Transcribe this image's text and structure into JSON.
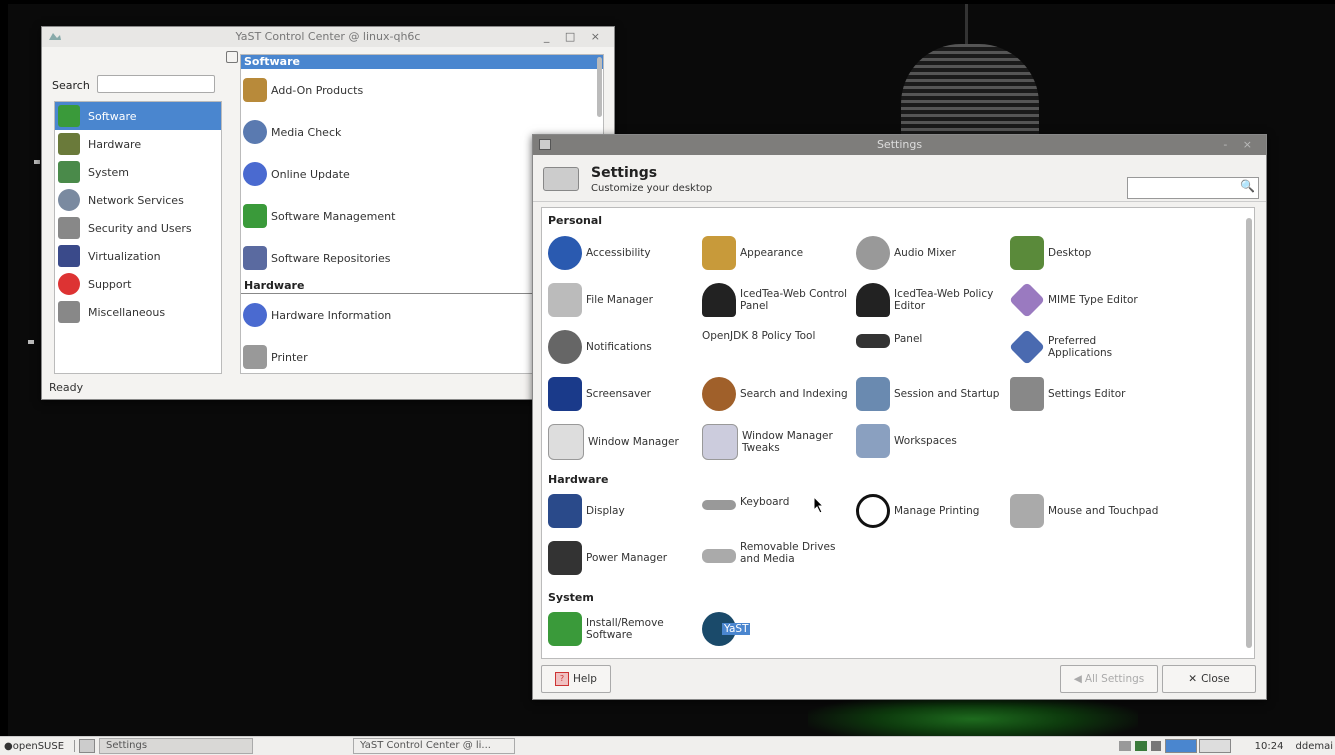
{
  "yast": {
    "title": "YaST Control Center @ linux-qh6c",
    "window_buttons": "_ □ ×",
    "search_label": "Search",
    "search_value": "",
    "categories": [
      {
        "label": "Software",
        "color": "#3a9a3a"
      },
      {
        "label": "Hardware",
        "color": "#6a7a3a"
      },
      {
        "label": "System",
        "color": "#4a8a4a"
      },
      {
        "label": "Network Services",
        "color": "#7a8aa0"
      },
      {
        "label": "Security and Users",
        "color": "#888"
      },
      {
        "label": "Virtualization",
        "color": "#3a4a8a"
      },
      {
        "label": "Support",
        "color": "#d33"
      },
      {
        "label": "Miscellaneous",
        "color": "#888"
      }
    ],
    "sections": {
      "software_header": "Software",
      "software_modules": [
        {
          "label": "Add-On Products",
          "color": "#b88a3a"
        },
        {
          "label": "Media Check",
          "color": "#5a7ab0"
        },
        {
          "label": "Online Update",
          "color": "#4a6ad0"
        },
        {
          "label": "Software Management",
          "color": "#3a9a3a"
        },
        {
          "label": "Software Repositories",
          "color": "#5a6aa0"
        }
      ],
      "hardware_header": "Hardware",
      "hardware_modules": [
        {
          "label": "Hardware Information",
          "color": "#4a6ad0"
        },
        {
          "label": "Printer",
          "color": "#999"
        }
      ]
    },
    "status": "Ready"
  },
  "settings": {
    "title": "Settings",
    "header_title": "Settings",
    "header_subtitle": "Customize your desktop",
    "search_icon": "🔍",
    "search_value": "",
    "personal_label": "Personal",
    "personal": [
      {
        "label": "Accessibility",
        "color": "#2a5ab0"
      },
      {
        "label": "Appearance",
        "color": "#c89a3a"
      },
      {
        "label": "Audio Mixer",
        "color": "#999"
      },
      {
        "label": "Desktop",
        "color": "#5a8a3a"
      },
      {
        "label": "File Manager",
        "color": "#bbb"
      },
      {
        "label": "IcedTea-Web Control Panel",
        "color": "#222"
      },
      {
        "label": "IcedTea-Web Policy Editor",
        "color": "#222"
      },
      {
        "label": "MIME Type Editor",
        "color": "#9a7ac0"
      },
      {
        "label": "Notifications",
        "color": "#666"
      },
      {
        "label": "OpenJDK 8 Policy Tool",
        "color": "#fff"
      },
      {
        "label": "Panel",
        "color": "#333"
      },
      {
        "label": "Preferred Applications",
        "color": "#4a6ab0"
      },
      {
        "label": "Screensaver",
        "color": "#1a3a8a"
      },
      {
        "label": "Search and Indexing",
        "color": "#a0602a"
      },
      {
        "label": "Session and Startup",
        "color": "#6a8ab0"
      },
      {
        "label": "Settings Editor",
        "color": "#888"
      },
      {
        "label": "Window Manager",
        "color": "#ddd"
      },
      {
        "label": "Window Manager Tweaks",
        "color": "#ccd"
      },
      {
        "label": "Workspaces",
        "color": "#8aa0c0"
      }
    ],
    "hardware_label": "Hardware",
    "hardware": [
      {
        "label": "Display",
        "color": "#2a4a8a"
      },
      {
        "label": "Keyboard",
        "color": "#999"
      },
      {
        "label": "Manage Printing",
        "color": "#111"
      },
      {
        "label": "Mouse and Touchpad",
        "color": "#aaa"
      },
      {
        "label": "Power Manager",
        "color": "#333"
      },
      {
        "label": "Removable Drives and Media",
        "color": "#aaa"
      }
    ],
    "system_label": "System",
    "system": [
      {
        "label": "Install/Remove Software",
        "color": "#3a9a3a"
      },
      {
        "label": "YaST",
        "color": "#1a4a6a"
      }
    ],
    "help_label": "Help",
    "all_settings_label": "All Settings",
    "close_label": "Close"
  },
  "taskbar": {
    "start_label": "openSUSE",
    "tasks": [
      {
        "label": "Settings"
      },
      {
        "label": "YaST Control Center @ li..."
      }
    ],
    "clock": "10:24",
    "user": "ddemai"
  },
  "colors": {
    "selection": "#4a86cf",
    "settings_titlebar": "#7e7d7b"
  }
}
